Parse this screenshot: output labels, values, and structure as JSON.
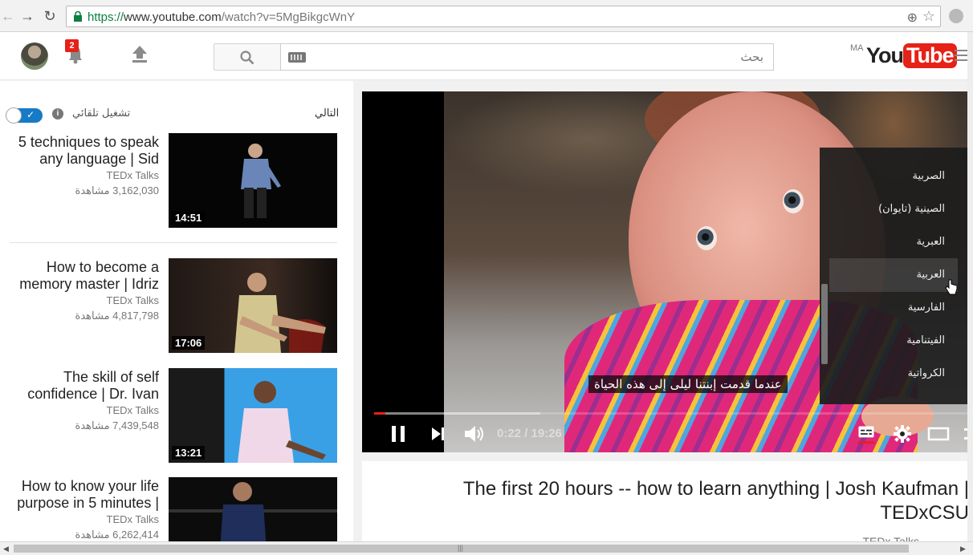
{
  "browser": {
    "url_scheme": "https://",
    "url_host": "www.youtube.com",
    "url_rest": "/watch?v=5MgBikgcWnY"
  },
  "masthead": {
    "notifications_count": "2",
    "search_placeholder": "بحث",
    "region": "MA",
    "logo_you": "You",
    "logo_tube": "Tube"
  },
  "sidebar": {
    "up_next": "التالي",
    "autoplay": "تشغيل تلقائي",
    "items": [
      {
        "title": "5 techniques to speak any language | Sid",
        "channel": "TEDx Talks",
        "views": "3,162,030 مشاهدة",
        "duration": "14:51"
      },
      {
        "title": "How to become a memory master | Idriz",
        "channel": "TEDx Talks",
        "views": "4,817,798 مشاهدة",
        "duration": "17:06"
      },
      {
        "title": "The skill of self confidence | Dr. Ivan",
        "channel": "TEDx Talks",
        "views": "7,439,548 مشاهدة",
        "duration": "13:21"
      },
      {
        "title": "How to know your life purpose in 5 minutes |",
        "channel": "TEDx Talks",
        "views": "6,262,414 مشاهدة",
        "duration": ""
      }
    ]
  },
  "player": {
    "caption": "عندما قدمت إبنتنا ليلى إلى هذه الحياة",
    "time": "0:22 / 19:26",
    "progress_played_fraction": 0.019,
    "progress_loaded_fraction": 0.28,
    "subtitle_menu": {
      "items": [
        "الصربية",
        "الصينية (تايوان)",
        "العبرية",
        "العربية",
        "الفارسية",
        "الفيتنامية",
        "الكرواتية"
      ],
      "selected": "العربية"
    }
  },
  "video": {
    "title": "The first 20 hours -- how to learn anything | Josh Kaufman | TEDxCSU",
    "channel": "TEDx Talks"
  }
}
